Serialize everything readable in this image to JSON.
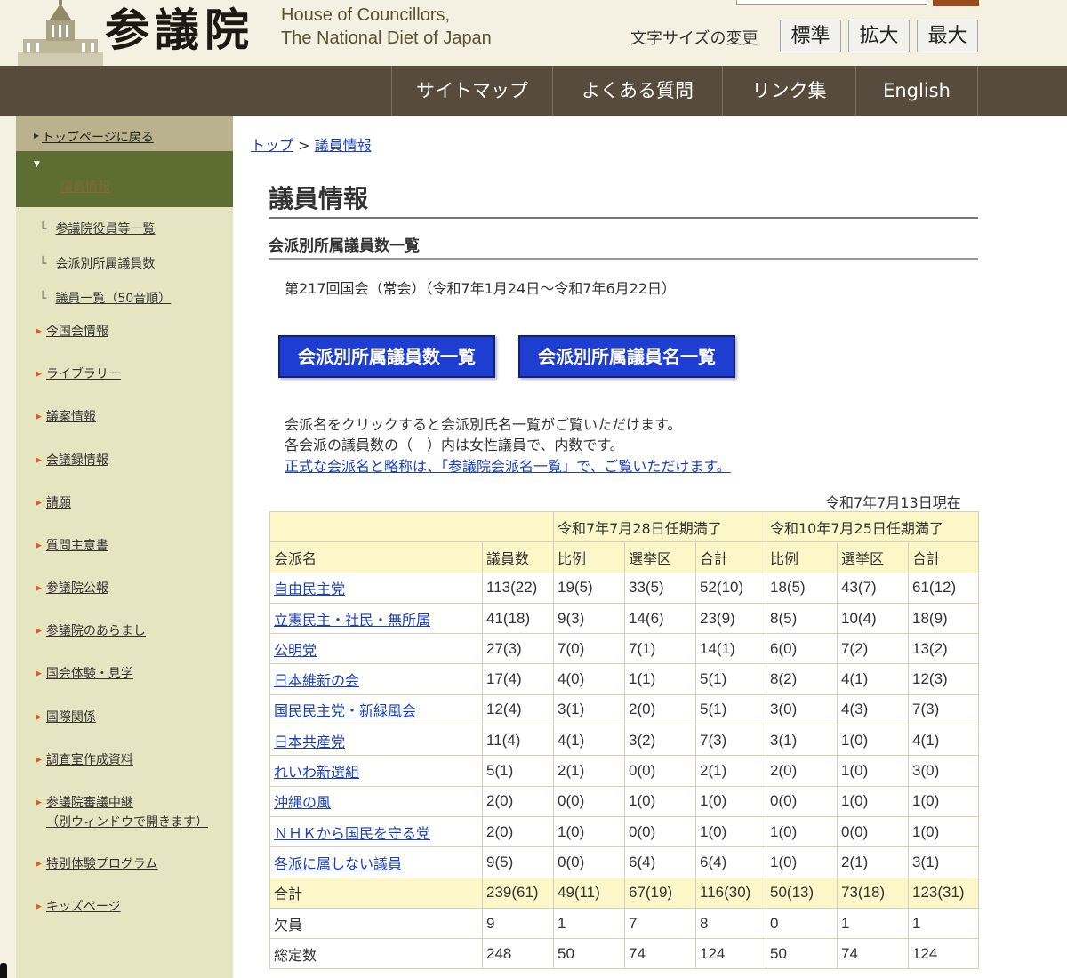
{
  "header": {
    "logo_kanji": "参議院",
    "logo_en_line1": "House of Councillors,",
    "logo_en_line2": "The National Diet of Japan",
    "fontsize_label": "文字サイズの変更",
    "fontsize_buttons": [
      "標準",
      "拡大",
      "最大"
    ]
  },
  "nav": [
    "サイトマップ",
    "よくある質問",
    "リンク集",
    "English"
  ],
  "sidebar": {
    "top_link": "トップページに戻る",
    "current": "議員情報",
    "sub_items": [
      "参議院役員等一覧",
      "会派別所属議員数",
      "議員一覧（50音順）"
    ],
    "items": [
      "今国会情報",
      "ライブラリー",
      "議案情報",
      "会議録情報",
      "請願",
      "質問主意書",
      "参議院公報",
      "参議院のあらまし",
      "国会体験・見学",
      "国際関係",
      "調査室作成資料",
      "参議院審議中継",
      "特別体験プログラム",
      "キッズページ"
    ],
    "item_note": "（別ウィンドウで開きます）"
  },
  "breadcrumb": {
    "top": "トップ",
    "sep": " > ",
    "current": "議員情報"
  },
  "page_title": "議員情報",
  "section_title": "会派別所属議員数一覧",
  "session": "第217回国会（常会）（令和7年1月24日～令和7年6月22日）",
  "buttons": {
    "count_list": "会派別所属議員数一覧",
    "name_list": "会派別所属議員名一覧"
  },
  "notes": {
    "line1": "会派名をクリックすると会派別氏名一覧がご覧いただけます。",
    "line2": "各会派の議員数の（　）内は女性議員で、内数です。",
    "link": "正式な会派名と略称は、「参議院会派名一覧」で、ご覧いただけます。"
  },
  "as_of": "令和7年7月13日現在",
  "table": {
    "group_headers": [
      "令和7年7月28日任期満了",
      "令和10年7月25日任期満了"
    ],
    "columns": [
      "会派名",
      "議員数",
      "比例",
      "選挙区",
      "合計",
      "比例",
      "選挙区",
      "合計"
    ],
    "rows": [
      [
        "自由民主党",
        "113(22)",
        "19(5)",
        "33(5)",
        "52(10)",
        "18(5)",
        "43(7)",
        "61(12)"
      ],
      [
        "立憲民主・社民・無所属",
        "41(18)",
        "9(3)",
        "14(6)",
        "23(9)",
        "8(5)",
        "10(4)",
        "18(9)"
      ],
      [
        "公明党",
        "27(3)",
        "7(0)",
        "7(1)",
        "14(1)",
        "6(0)",
        "7(2)",
        "13(2)"
      ],
      [
        "日本維新の会",
        "17(4)",
        "4(0)",
        "1(1)",
        "5(1)",
        "8(2)",
        "4(1)",
        "12(3)"
      ],
      [
        "国民民主党・新緑風会",
        "12(4)",
        "3(1)",
        "2(0)",
        "5(1)",
        "3(0)",
        "4(3)",
        "7(3)"
      ],
      [
        "日本共産党",
        "11(4)",
        "4(1)",
        "3(2)",
        "7(3)",
        "3(1)",
        "1(0)",
        "4(1)"
      ],
      [
        "れいわ新選組",
        "5(1)",
        "2(1)",
        "0(0)",
        "2(1)",
        "2(0)",
        "1(0)",
        "3(0)"
      ],
      [
        "沖縄の風",
        "2(0)",
        "0(0)",
        "1(0)",
        "1(0)",
        "0(0)",
        "1(0)",
        "1(0)"
      ],
      [
        "ＮＨＫから国民を守る党",
        "2(0)",
        "1(0)",
        "0(0)",
        "1(0)",
        "1(0)",
        "0(0)",
        "1(0)"
      ],
      [
        "各派に属しない議員",
        "9(5)",
        "0(0)",
        "6(4)",
        "6(4)",
        "1(0)",
        "2(1)",
        "3(1)"
      ]
    ],
    "summary": [
      [
        "合計",
        "239(61)",
        "49(11)",
        "67(19)",
        "116(30)",
        "50(13)",
        "73(18)",
        "123(31)"
      ],
      [
        "欠員",
        "9",
        "1",
        "7",
        "8",
        "0",
        "1",
        "1"
      ],
      [
        "総定数",
        "248",
        "50",
        "74",
        "124",
        "50",
        "74",
        "124"
      ]
    ]
  },
  "colors": {
    "nav_bg": "#574b3d",
    "sidebar_bg": "#e6e5c2",
    "current_bg": "#5e6e32",
    "button_bg": "#1e3dd1",
    "link": "#1a3fb8",
    "table_head": "#fcf7c8"
  }
}
